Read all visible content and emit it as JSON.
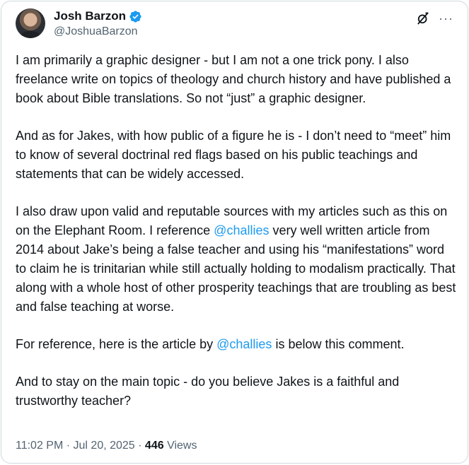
{
  "author": {
    "display_name": "Josh Barzon",
    "handle": "@JoshuaBarzon",
    "verified_color": "#1d9bf0"
  },
  "icons": {
    "verified": "verified-badge-icon",
    "grok": "grok-icon",
    "more": "more-icon"
  },
  "post": {
    "p1": "I am primarily a graphic designer - but I am not a one trick pony. I also freelance write on topics of theology and church history and have published a book about Bible translations. So not “just” a graphic designer.",
    "p2": "And as for Jakes, with how public of a figure he is - I don’t need to “meet” him to know of several doctrinal red flags based on his public teachings and statements that can be widely accessed.",
    "p3_a": "I also draw upon valid and reputable sources with my articles such as this on on the Elephant Room. I reference ",
    "p3_mention": "@challies",
    "p3_b": " very well written article from 2014 about Jake’s being a false teacher and using his “manifestations” word to claim he is trinitarian while still actually holding to modalism practically. That along with a whole host of other prosperity teachings that are troubling as best and false teaching at worse.",
    "p4_a": "For reference, here is the article by ",
    "p4_mention": "@challies",
    "p4_b": " is below this comment.",
    "p5": "And to stay on the main topic - do you believe Jakes is a faithful and trustworthy teacher?"
  },
  "meta": {
    "time": "11:02 PM",
    "sep1": " · ",
    "date": "Jul 20, 2025",
    "sep2": " · ",
    "views_count": "446",
    "views_label": " Views"
  },
  "more_glyph": "···"
}
